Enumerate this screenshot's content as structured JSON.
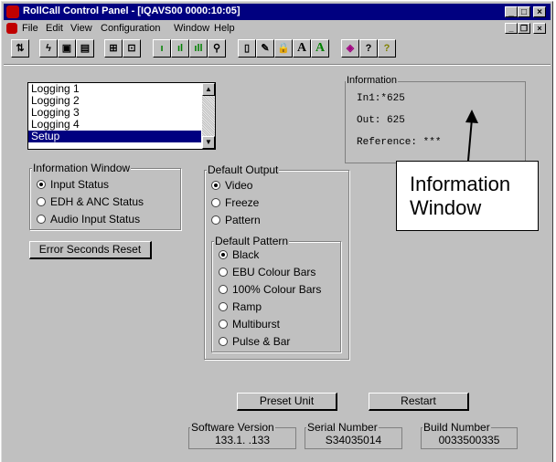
{
  "window": {
    "title": "RollCall Control Panel - [IQAVS00 0000:10:05]"
  },
  "titlebar_buttons": {
    "minimize": "_",
    "maximize": "□",
    "close": "×"
  },
  "mdi_buttons": {
    "minimize": "_",
    "restore": "❐",
    "close": "×"
  },
  "menu": {
    "items": [
      "File",
      "Edit",
      "View",
      "Configuration",
      "Window",
      "Help"
    ]
  },
  "toolbar": {
    "buttons": [
      {
        "icon": "connect-icon",
        "glyph": "⇅"
      },
      {
        "icon": "lightning-icon",
        "glyph": "ϟ"
      },
      {
        "icon": "save-icon",
        "glyph": "▣"
      },
      {
        "icon": "save-all-icon",
        "glyph": "▤"
      },
      {
        "icon": "network-icon",
        "glyph": "⊞"
      },
      {
        "icon": "device-icon",
        "glyph": "⊡"
      },
      {
        "icon": "bar-1-icon",
        "glyph": "ı",
        "accent": "#008000"
      },
      {
        "icon": "bar-2-icon",
        "glyph": "ıl",
        "accent": "#008000"
      },
      {
        "icon": "bar-3-icon",
        "glyph": "ıll",
        "accent": "#008000"
      },
      {
        "icon": "search-icon",
        "glyph": "⚲"
      },
      {
        "icon": "book-icon",
        "glyph": "▯"
      },
      {
        "icon": "edit-icon",
        "glyph": "✎"
      },
      {
        "icon": "lock-icon",
        "glyph": "🔒"
      },
      {
        "icon": "font-a-icon",
        "glyph": "A"
      },
      {
        "icon": "font-a-green-icon",
        "glyph": "A",
        "accent": "#008000"
      },
      {
        "icon": "eraser-icon",
        "glyph": "◈"
      },
      {
        "icon": "help-icon",
        "glyph": "?"
      },
      {
        "icon": "context-help-icon",
        "glyph": "?"
      }
    ]
  },
  "log_list": {
    "items": [
      "Logging 1",
      "Logging 2",
      "Logging 3",
      "Logging 4",
      "Setup"
    ],
    "selected_index": 4
  },
  "information_window": {
    "legend": "Information Window",
    "options": [
      "Input Status",
      "EDH & ANC Status",
      "Audio Input Status"
    ],
    "selected": 0
  },
  "error_reset_label": "Error Seconds Reset",
  "default_output": {
    "legend": "Default Output",
    "options": [
      "Video",
      "Freeze",
      "Pattern"
    ],
    "selected": 0
  },
  "default_pattern": {
    "legend": "Default Pattern",
    "options": [
      "Black",
      "EBU Colour Bars",
      "100% Colour Bars",
      "Ramp",
      "Multiburst",
      "Pulse & Bar"
    ],
    "selected": 0
  },
  "information": {
    "legend": "Information",
    "lines": [
      "In1:*625",
      "Out: 625",
      "Reference: ***"
    ]
  },
  "annotation": {
    "line1": "Information",
    "line2": "Window"
  },
  "preset_unit_label": "Preset Unit",
  "restart_label": "Restart",
  "software_version": {
    "legend": "Software Version",
    "value": "133.1. .133"
  },
  "serial_number": {
    "legend": "Serial Number",
    "value": "S34035014"
  },
  "build_number": {
    "legend": "Build Number",
    "value": "0033500335"
  },
  "colors": {
    "titlebar": "#000080",
    "face": "#c0c0c0",
    "selection": "#000080"
  }
}
